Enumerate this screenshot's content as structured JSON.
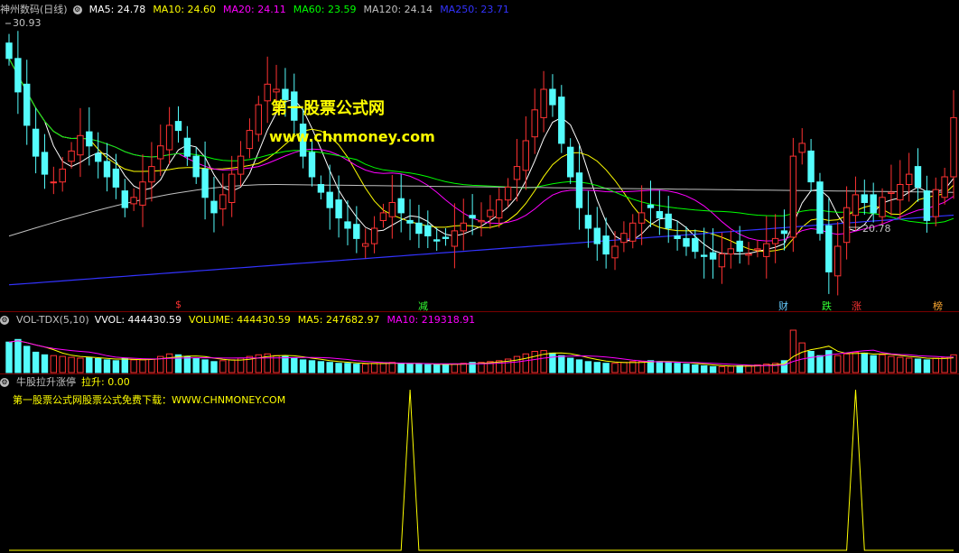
{
  "main_panel": {
    "title": "神州数码(日线)",
    "ma": [
      {
        "label": "MA5: 24.78",
        "color": "#ffffff"
      },
      {
        "label": "MA10: 24.60",
        "color": "#ffff00"
      },
      {
        "label": "MA20: 24.11",
        "color": "#ff00ff"
      },
      {
        "label": "MA60: 23.59",
        "color": "#00ff00"
      },
      {
        "label": "MA120: 24.14",
        "color": "#c0c0c0"
      },
      {
        "label": "MA250: 23.71",
        "color": "#3333ff"
      }
    ],
    "high_label": "30.93",
    "low_label": "20.78",
    "watermark_cn": "第一股票公式网",
    "watermark_url": "www.chnmoney.com",
    "events": [
      {
        "text": "$",
        "color": "#ff3333"
      },
      {
        "text": "减",
        "color": "#33ff33"
      },
      {
        "text": "财",
        "color": "#66ccff"
      },
      {
        "text": "跌",
        "color": "#33ff33"
      },
      {
        "text": "涨",
        "color": "#ff3333"
      },
      {
        "text": "榜",
        "color": "#ffaa33"
      }
    ]
  },
  "volume_panel": {
    "name": "VOL-TDX(5,10)",
    "vvol": "VVOL: 444430.59",
    "volume": "VOLUME: 444430.59",
    "ma5": "MA5: 247682.97",
    "ma10": "MA10: 219318.91"
  },
  "indicator_panel": {
    "name": "牛股拉升涨停",
    "value": "拉升: 0.00",
    "text": "第一股票公式网股票公式免费下载：WWW.CHNMONEY.COM"
  },
  "colors": {
    "up": "#ff3232",
    "down": "#54fcfc",
    "separator": "#7a0000"
  },
  "chart_data": {
    "type": "candlestick",
    "price_range": [
      20.5,
      31.3
    ],
    "closes": [
      29.8,
      28.5,
      27.2,
      26.0,
      25.3,
      25.0,
      25.5,
      26.2,
      26.8,
      26.4,
      25.8,
      25.2,
      24.8,
      24.0,
      24.4,
      25.0,
      25.6,
      26.4,
      27.2,
      27.0,
      26.0,
      25.2,
      24.4,
      23.8,
      24.5,
      25.3,
      26.0,
      27.0,
      28.0,
      28.8,
      28.6,
      28.2,
      27.4,
      26.0,
      25.2,
      24.6,
      24.0,
      23.6,
      23.2,
      22.8,
      22.6,
      23.2,
      23.8,
      24.2,
      23.8,
      23.4,
      23.0,
      22.9,
      22.7,
      22.8,
      23.1,
      23.4,
      23.6,
      23.5,
      23.9,
      24.3,
      24.8,
      25.6,
      26.6,
      27.8,
      28.6,
      28.0,
      26.5,
      25.2,
      24.0,
      23.2,
      22.6,
      22.2,
      22.5,
      23.0,
      23.4,
      23.8,
      24.0,
      23.6,
      23.2,
      22.8,
      22.5,
      22.3,
      22.1,
      22.0,
      22.2,
      22.4,
      22.3,
      22.2,
      22.4,
      22.6,
      22.8,
      23.0,
      26.0,
      26.5,
      25.0,
      23.0,
      21.5,
      22.5,
      24.0,
      24.5,
      24.2,
      23.8,
      24.4,
      24.6,
      24.9,
      25.3,
      24.8,
      23.5,
      24.7,
      25.2,
      27.5
    ],
    "volumes": [
      0.72,
      0.78,
      0.62,
      0.48,
      0.42,
      0.4,
      0.38,
      0.36,
      0.34,
      0.35,
      0.33,
      0.3,
      0.28,
      0.34,
      0.3,
      0.3,
      0.32,
      0.38,
      0.44,
      0.42,
      0.38,
      0.34,
      0.3,
      0.26,
      0.28,
      0.3,
      0.34,
      0.38,
      0.42,
      0.44,
      0.4,
      0.38,
      0.34,
      0.3,
      0.28,
      0.26,
      0.24,
      0.22,
      0.22,
      0.2,
      0.2,
      0.22,
      0.22,
      0.24,
      0.22,
      0.2,
      0.2,
      0.19,
      0.18,
      0.2,
      0.2,
      0.22,
      0.24,
      0.24,
      0.26,
      0.28,
      0.32,
      0.38,
      0.44,
      0.5,
      0.52,
      0.46,
      0.4,
      0.34,
      0.3,
      0.26,
      0.24,
      0.22,
      0.22,
      0.24,
      0.26,
      0.26,
      0.28,
      0.26,
      0.24,
      0.22,
      0.2,
      0.18,
      0.16,
      0.14,
      0.14,
      0.15,
      0.16,
      0.16,
      0.18,
      0.2,
      0.22,
      0.28,
      1.0,
      0.7,
      0.5,
      0.4,
      0.52,
      0.4,
      0.44,
      0.48,
      0.46,
      0.4,
      0.42,
      0.38,
      0.36,
      0.34,
      0.32,
      0.3,
      0.34,
      0.36,
      0.42
    ],
    "signals": [
      0,
      0,
      0,
      0,
      0,
      0,
      0,
      0,
      0,
      0,
      0,
      0,
      0,
      0,
      0,
      0,
      0,
      0,
      0,
      0,
      0,
      0,
      0,
      0,
      0,
      0,
      0,
      0,
      0,
      0,
      0,
      0,
      0,
      0,
      0,
      0,
      0,
      0,
      0,
      0,
      0,
      0,
      0,
      0,
      0,
      1,
      0,
      0,
      0,
      0,
      0,
      0,
      0,
      0,
      0,
      0,
      0,
      0,
      0,
      0,
      0,
      0,
      0,
      0,
      0,
      0,
      0,
      0,
      0,
      0,
      0,
      0,
      0,
      0,
      0,
      0,
      0,
      0,
      0,
      0,
      0,
      0,
      0,
      0,
      0,
      0,
      0,
      0,
      0,
      0,
      0,
      0,
      0,
      0,
      0,
      1,
      0,
      0,
      0,
      0,
      0,
      0,
      0,
      0,
      0,
      0,
      0
    ]
  }
}
